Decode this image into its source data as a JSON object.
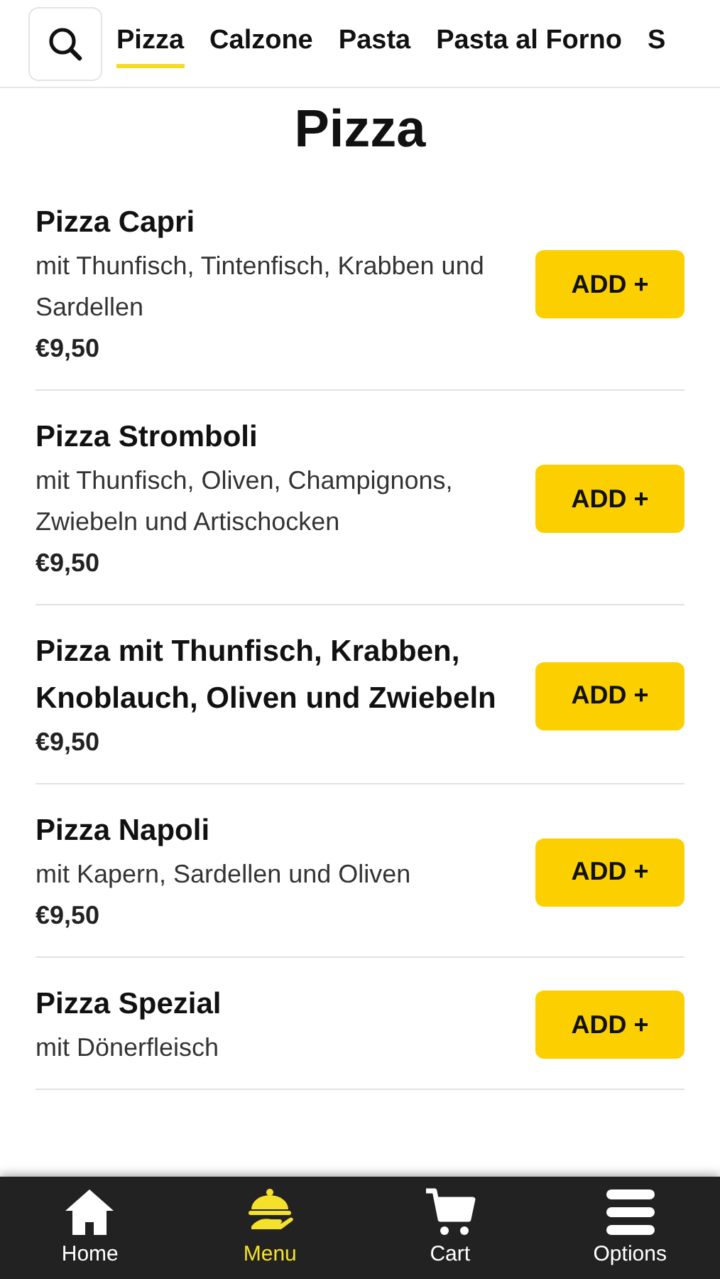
{
  "tabs": [
    {
      "label": "Pizza",
      "selected": true
    },
    {
      "label": "Calzone",
      "selected": false
    },
    {
      "label": "Pasta",
      "selected": false
    },
    {
      "label": "Pasta al Forno",
      "selected": false
    },
    {
      "label": "S",
      "selected": false
    }
  ],
  "section_title": "Pizza",
  "items": [
    {
      "name": "Pizza Capri",
      "description": "mit Thunfisch, Tintenfisch, Krabben und Sardellen",
      "price": "€9,50",
      "button": "ADD +"
    },
    {
      "name": "Pizza Stromboli",
      "description": "mit Thunfisch, Oliven, Champignons, Zwiebeln und Artischocken",
      "price": "€9,50",
      "button": "ADD +"
    },
    {
      "name": "Pizza mit Thunfisch, Krabben, Knoblauch, Oliven und Zwiebeln",
      "price": "€9,50",
      "button": "ADD +"
    },
    {
      "name": "Pizza Napoli",
      "description": "mit Kapern, Sardellen und Oliven",
      "price": "€9,50",
      "button": "ADD +"
    },
    {
      "name": "Pizza Spezial",
      "description": "mit Dönerfleisch",
      "button": "ADD +"
    }
  ],
  "bottom_nav": [
    {
      "kind": "home",
      "label": "Home",
      "selected": false
    },
    {
      "kind": "menu",
      "label": "Menu",
      "selected": true
    },
    {
      "kind": "cart",
      "label": "Cart",
      "selected": false
    },
    {
      "kind": "options",
      "label": "Options",
      "selected": false
    }
  ]
}
